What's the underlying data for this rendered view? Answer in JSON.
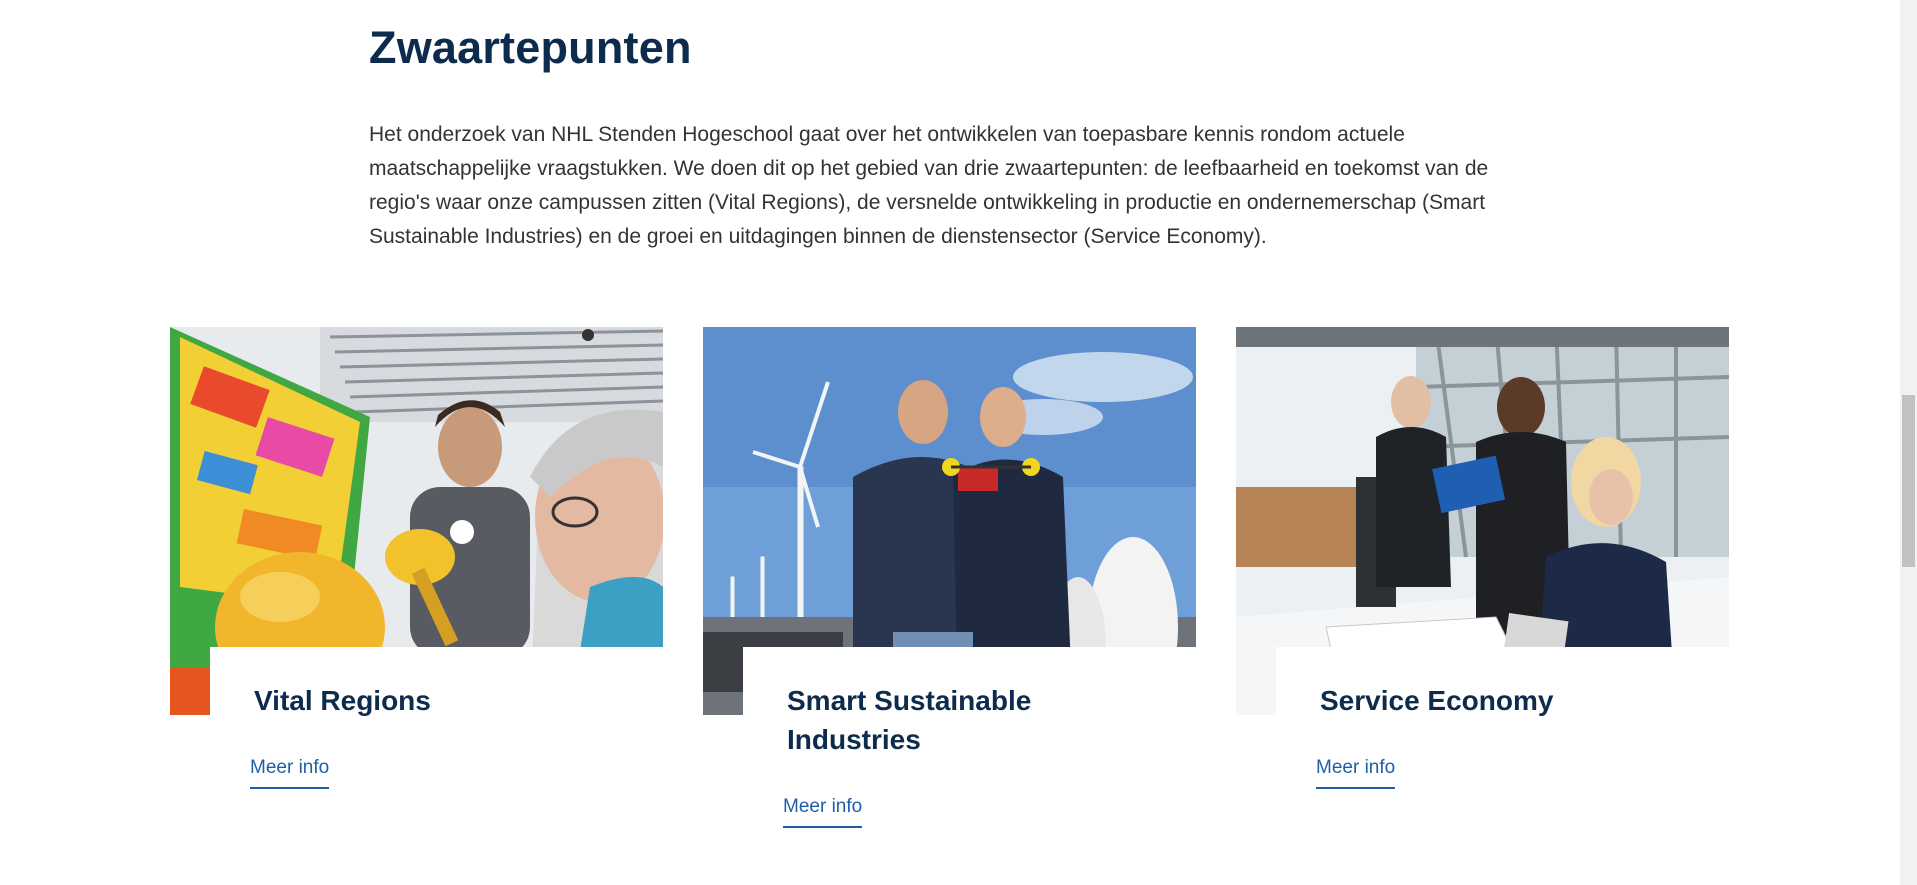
{
  "section": {
    "title": "Zwaartepunten",
    "intro": "Het onderzoek van NHL Stenden Hogeschool gaat over het ontwikkelen van toepasbare kennis rondom actuele maatschappelijke vraagstukken. We doen dit op het gebied van drie zwaartepunten: de leefbaarheid en toekomst van de regio's waar onze campussen zitten (Vital Regions), de versnelde ontwikkeling in productie en ondernemerschap (Smart Sustainable Industries) en de groei en uitdagingen binnen de dienstensector (Service Economy)."
  },
  "cards": [
    {
      "title": "Vital Regions",
      "link": "Meer info"
    },
    {
      "title": "Smart Sustainable Industries",
      "link": "Meer info"
    },
    {
      "title": "Service Economy",
      "link": "Meer info"
    }
  ],
  "colors": {
    "heading": "#0d2b4d",
    "link": "#1f5fa8",
    "body_text": "#333333"
  }
}
